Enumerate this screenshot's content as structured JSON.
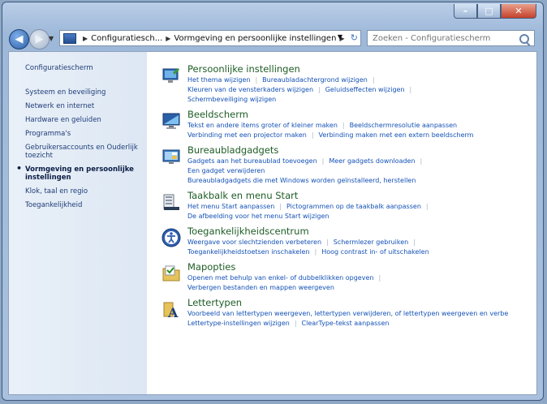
{
  "address": {
    "segments": [
      "Configuratiesch...",
      "Vormgeving en persoonlijke instellingen"
    ]
  },
  "search": {
    "placeholder": "Zoeken - Configuratiescherm"
  },
  "sidebar": {
    "items": [
      {
        "label": "Configuratiescherm"
      },
      {
        "label": "Systeem en beveiliging"
      },
      {
        "label": "Netwerk en internet"
      },
      {
        "label": "Hardware en geluiden"
      },
      {
        "label": "Programma's"
      },
      {
        "label": "Gebruikersaccounts en Ouderlijk toezicht"
      },
      {
        "label": "Vormgeving en persoonlijke instellingen"
      },
      {
        "label": "Klok, taal en regio"
      },
      {
        "label": "Toegankelijkheid"
      }
    ]
  },
  "categories": [
    {
      "title": "Persoonlijke instellingen",
      "rows": [
        [
          "Het thema wijzigen",
          "Bureaubladachtergrond wijzigen"
        ],
        [
          "Kleuren van de vensterkaders wijzigen",
          "Geluidseffecten wijzigen"
        ],
        [
          "Schermbeveiliging wijzigen"
        ]
      ]
    },
    {
      "title": "Beeldscherm",
      "rows": [
        [
          "Tekst en andere items groter of kleiner maken",
          "Beeldschermresolutie aanpassen"
        ],
        [
          "Verbinding met een projector maken",
          "Verbinding maken met een extern beeldscherm"
        ]
      ]
    },
    {
      "title": "Bureaubladgadgets",
      "rows": [
        [
          "Gadgets aan het bureaublad toevoegen",
          "Meer gadgets downloaden"
        ],
        [
          "Een gadget verwijderen"
        ],
        [
          "Bureaubladgadgets die met Windows worden geïnstalleerd, herstellen"
        ]
      ]
    },
    {
      "title": "Taakbalk en menu Start",
      "rows": [
        [
          "Het menu Start aanpassen",
          "Pictogrammen op de taakbalk aanpassen"
        ],
        [
          "De afbeelding voor het menu Start wijzigen"
        ]
      ]
    },
    {
      "title": "Toegankelijkheidscentrum",
      "rows": [
        [
          "Weergave voor slechtzienden verbeteren",
          "Schermlezer gebruiken"
        ],
        [
          "Toegankelijkheidstoetsen inschakelen",
          "Hoog contrast in- of uitschakelen"
        ]
      ]
    },
    {
      "title": "Mapopties",
      "rows": [
        [
          "Openen met behulp van enkel- of dubbelklikken opgeven"
        ],
        [
          "Verbergen bestanden en mappen weergeven"
        ]
      ]
    },
    {
      "title": "Lettertypen",
      "rows": [
        [
          "Voorbeeld van lettertypen weergeven, lettertypen verwijderen, of lettertypen weergeven en verbe"
        ],
        [
          "Lettertype-instellingen wijzigen",
          "ClearType-tekst aanpassen"
        ]
      ]
    }
  ]
}
